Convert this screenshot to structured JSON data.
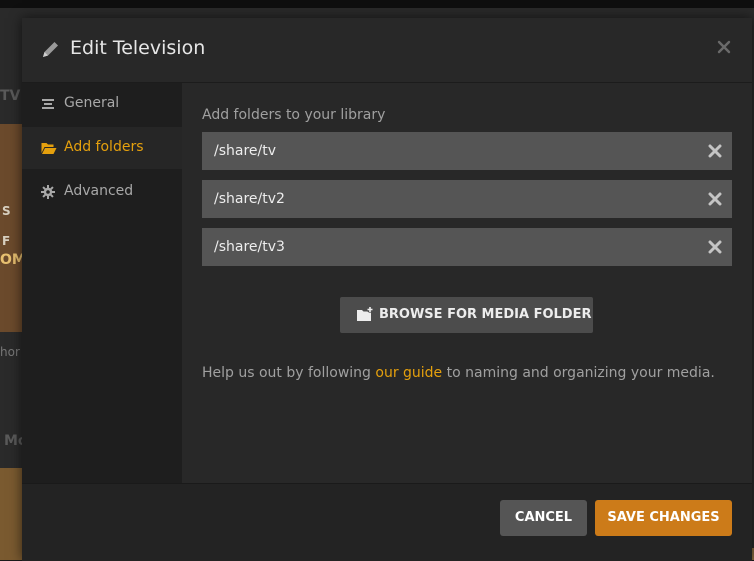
{
  "background": {
    "labels": [
      "TV",
      "S",
      "F",
      "OM",
      "hor",
      "Mo"
    ]
  },
  "modal": {
    "title": "Edit Television",
    "icons": {
      "title": "pencil-icon",
      "close": "close-icon"
    }
  },
  "sidebar": {
    "items": [
      {
        "label": "General",
        "icon": "list-icon",
        "active": false
      },
      {
        "label": "Add folders",
        "icon": "folder-open-icon",
        "active": true
      },
      {
        "label": "Advanced",
        "icon": "gear-icon",
        "active": false
      }
    ]
  },
  "content": {
    "section_label": "Add folders to your library",
    "folders": [
      {
        "value": "/share/tv"
      },
      {
        "value": "/share/tv2"
      },
      {
        "value": "/share/tv3"
      }
    ],
    "browse_button": "BROWSE FOR MEDIA FOLDER",
    "help": {
      "before": "Help us out by following ",
      "link": "our guide",
      "after": " to naming and organizing your media."
    }
  },
  "footer": {
    "cancel_label": "CANCEL",
    "save_label": "SAVE CHANGES"
  },
  "colors": {
    "accent": "#e5a00d",
    "save_button": "#cc7b19",
    "modal_bg": "#282828",
    "sidebar_bg": "#1e1e1e",
    "input_bg": "#555555"
  }
}
